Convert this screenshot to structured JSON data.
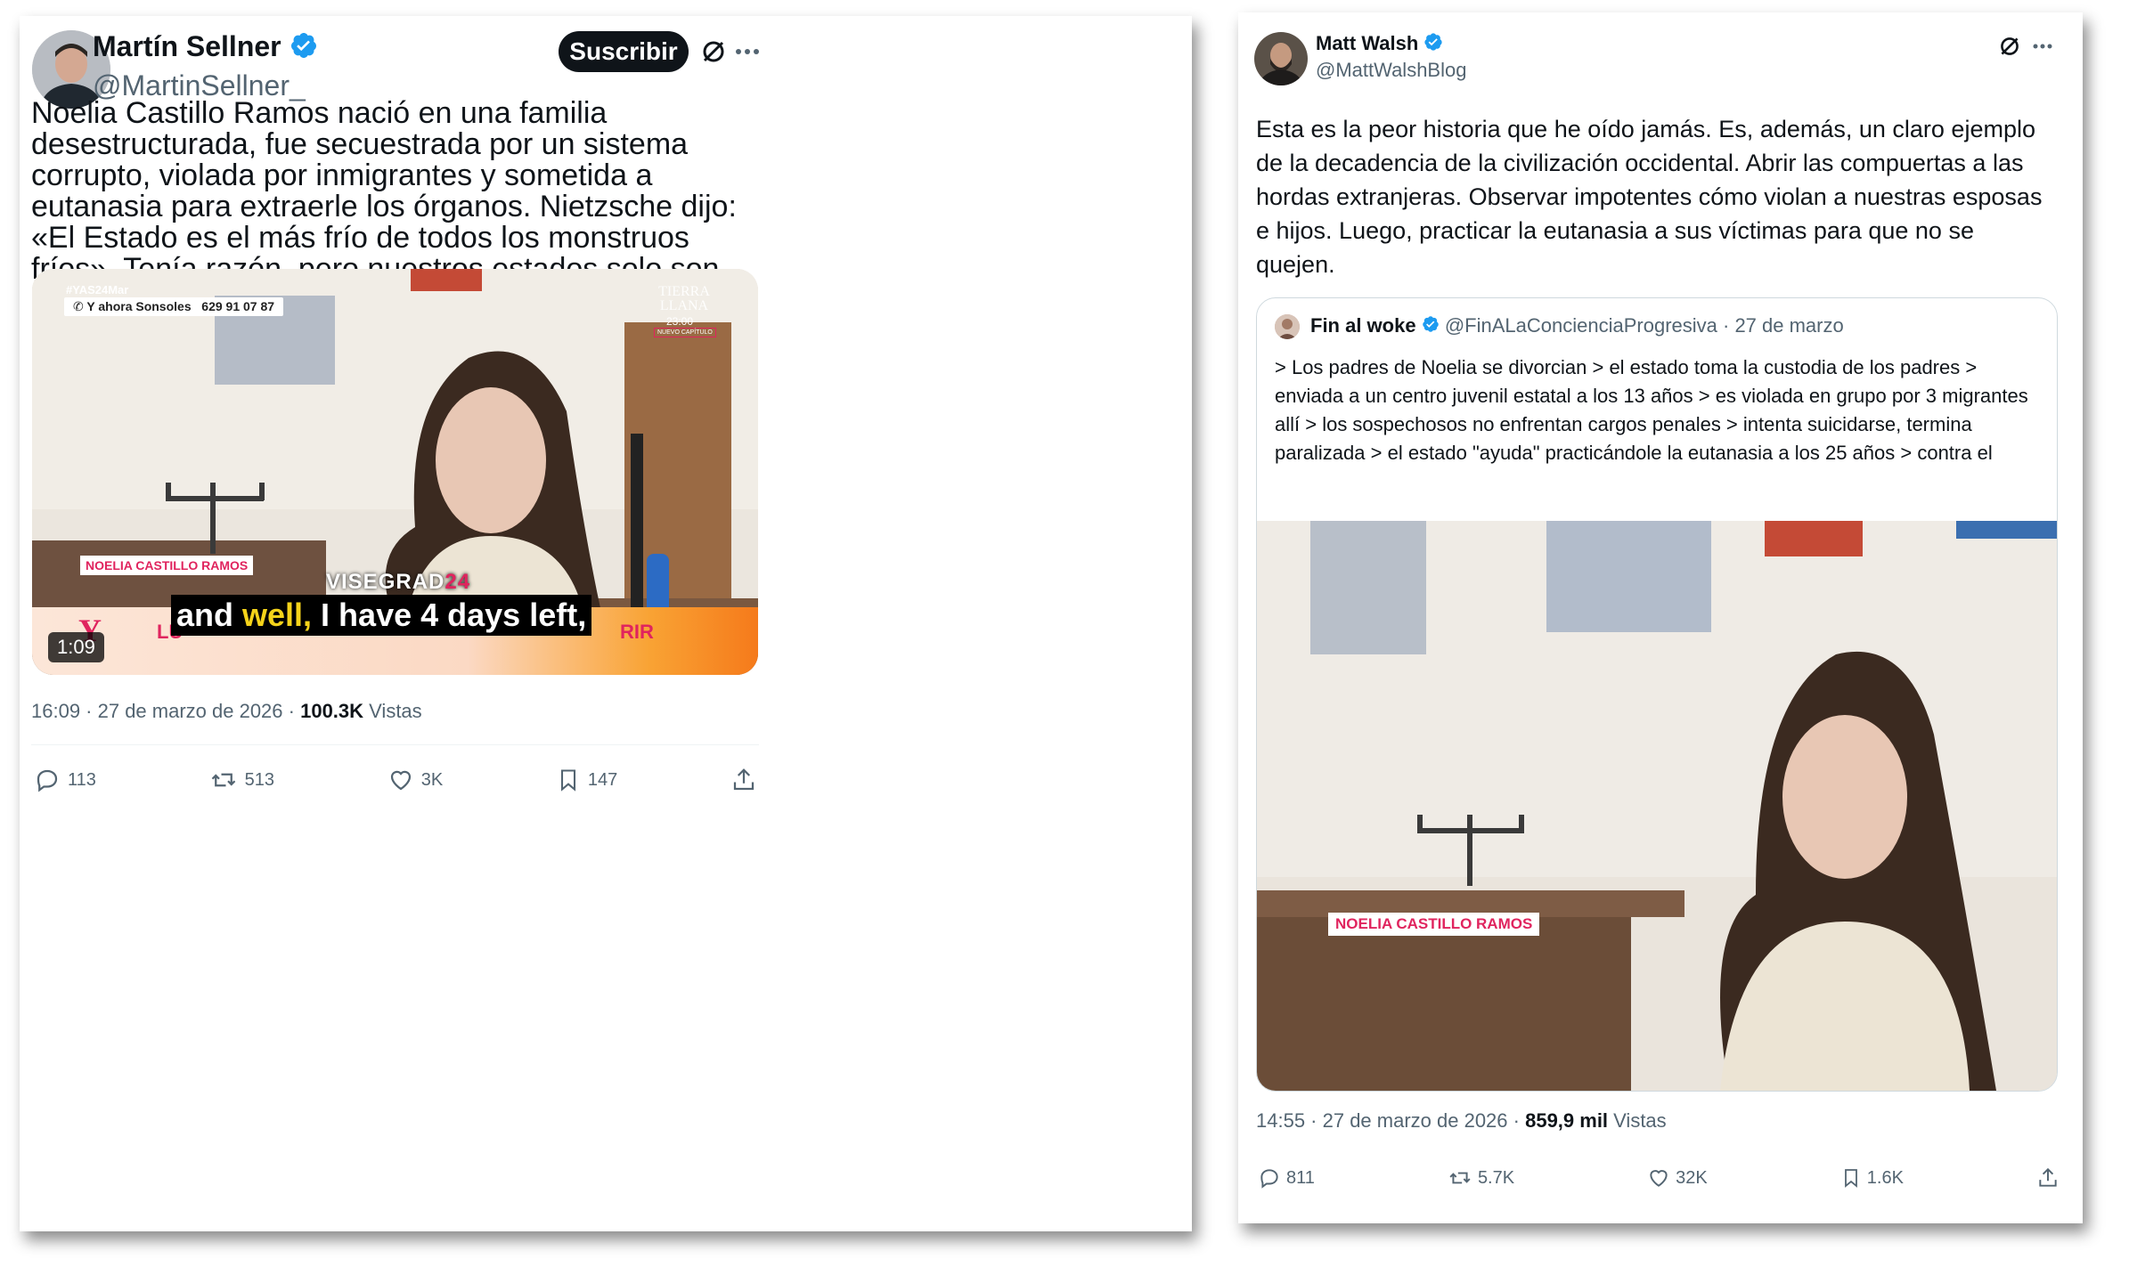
{
  "post1": {
    "author_name": "Martín Sellner",
    "author_handle": "@MartinSellner_",
    "subscribe_label": "Suscribir",
    "text": "Noelia Castillo Ramos nació en una familia desestructurada, fue secuestrada por un sistema corrupto, violada por inmigrantes y sometida a eutanasia para extraerle los órganos. Nietzsche dijo: «El Estado es el más frío de todos los monstruos fríos». Tenía razón, pero nuestros estados solo son monstruosos con su propio pueblo.",
    "video": {
      "hashtag": "#YAS24Mar",
      "phone_label": "Y ahora Sonsoles",
      "phone_number": "629 91 07 87",
      "channel_logo": "TIERRA LLANA",
      "channel_time": "23:00",
      "channel_sub": "NUEVO CAPÍTULO",
      "name_tag": "NOELIA CASTILLO RAMOS",
      "watermark_a": "VISEGRAD",
      "watermark_b": "24",
      "subtitle_a": "and ",
      "subtitle_highlight": "well,",
      "subtitle_b": " I have 4 days left,",
      "bar_left": "LU",
      "bar_right": "RIR",
      "duration": "1:09"
    },
    "time": "16:09 · 27 de marzo de 2026 · ",
    "views_count": "100.3K",
    "views_label": " Vistas",
    "replies": "113",
    "reposts": "513",
    "likes": "3K",
    "bookmarks": "147"
  },
  "post2": {
    "author_name": "Matt Walsh",
    "author_handle": "@MattWalshBlog",
    "text": "Esta es la peor historia que he oído jamás. Es, además, un claro ejemplo de la decadencia de la civilización occidental. Abrir las compuertas a las hordas extranjeras. Observar impotentes cómo violan a nuestras esposas e hijos. Luego, practicar la eutanasia a sus víctimas para que no se quejen.",
    "quote": {
      "author_name": "Fin al woke",
      "author_handle": "@FinALaConcienciaProgresiva",
      "date": " · 27 de marzo",
      "text": "> Los padres de Noelia se divorcian > el estado toma la custodia de los padres > enviada a un centro juvenil estatal a los 13 años > es violada en grupo por 3 migrantes allí > los sospechosos no enfrentan cargos penales > intenta suicidarse, termina paralizada > el estado \"ayuda\" practicándole la eutanasia a los 25 años > contra el",
      "name_tag": "NOELIA CASTILLO RAMOS"
    },
    "time": "14:55 · 27 de marzo de 2026 · ",
    "views_count": "859,9 mil",
    "views_label": " Vistas",
    "replies": "811",
    "reposts": "5.7K",
    "likes": "32K",
    "bookmarks": "1.6K"
  },
  "colors": {
    "verified": "#1d9bf0",
    "text": "#0f1419",
    "secondary": "#536471",
    "subtitle_highlight": "#f5d31a",
    "name_tag": "#e0245e"
  }
}
